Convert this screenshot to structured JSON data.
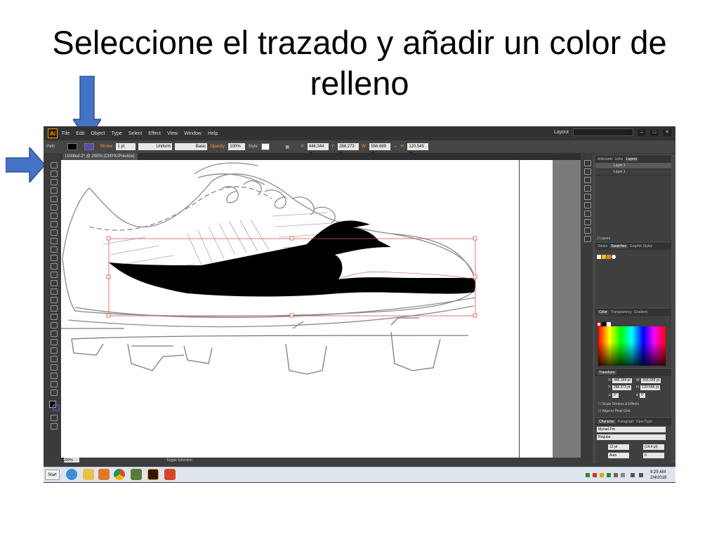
{
  "slide": {
    "title": "Seleccione el trazado y añadir un color de relleno"
  },
  "app": {
    "logo": "Ai",
    "menu": [
      "File",
      "Edit",
      "Object",
      "Type",
      "Select",
      "Effect",
      "View",
      "Window",
      "Help"
    ],
    "workspace": "Layout",
    "window_controls": [
      "–",
      "□",
      "✕"
    ]
  },
  "control_bar": {
    "selection_type": "Path",
    "stroke_label": "Stroke:",
    "stroke_weight": "1 pt",
    "profile": "Uniform",
    "brush": "Basic",
    "opacity_label": "Opacity:",
    "opacity": "100%",
    "style_label": "Style:",
    "x": "446.344 pt",
    "y": "288.273 pt",
    "w": "556.689 pt",
    "h": "120.545 pt"
  },
  "document": {
    "tab_label": "Untitled-2* @ 200% (CMYK/Preview)"
  },
  "status_bar": {
    "zoom": "200%",
    "toggle": "Toggle Selection"
  },
  "layers_panel": {
    "tabs": [
      "Artboards",
      "Links",
      "Layers"
    ],
    "layers": [
      "Layer 2",
      "Layer 1"
    ],
    "count": "2 Layers"
  },
  "swatches_panel": {
    "tabs": [
      "Stroke",
      "Swatches",
      "Graphic Styles"
    ]
  },
  "color_panel": {
    "tabs": [
      "Color",
      "Transparency",
      "Gradient"
    ]
  },
  "transform_panel": {
    "title": "Transform",
    "x": "446.344 pt",
    "y": "288.273 pt",
    "w": "556.689 pt",
    "h": "120.545 pt",
    "angle": "0°",
    "shear": "0°",
    "scale_strokes": "Scale Strokes & Effects",
    "align_pixel": "Align to Pixel Grid"
  },
  "character_panel": {
    "tabs": [
      "Character",
      "Paragraph",
      "OpenType"
    ],
    "font": "Myriad Pro",
    "style": "Regular",
    "size": "12 pt",
    "leading": "(14.4 pt)",
    "kerning": "Auto",
    "tracking": "0"
  },
  "taskbar": {
    "start": "Start",
    "time": "9:25 AM",
    "date": "2/4/2016"
  },
  "colors": {
    "arrow_fill": "#4472c4",
    "arrow_stroke": "#2f528f",
    "ai_orange": "#ff9a00",
    "selection_red": "#d9534f"
  }
}
